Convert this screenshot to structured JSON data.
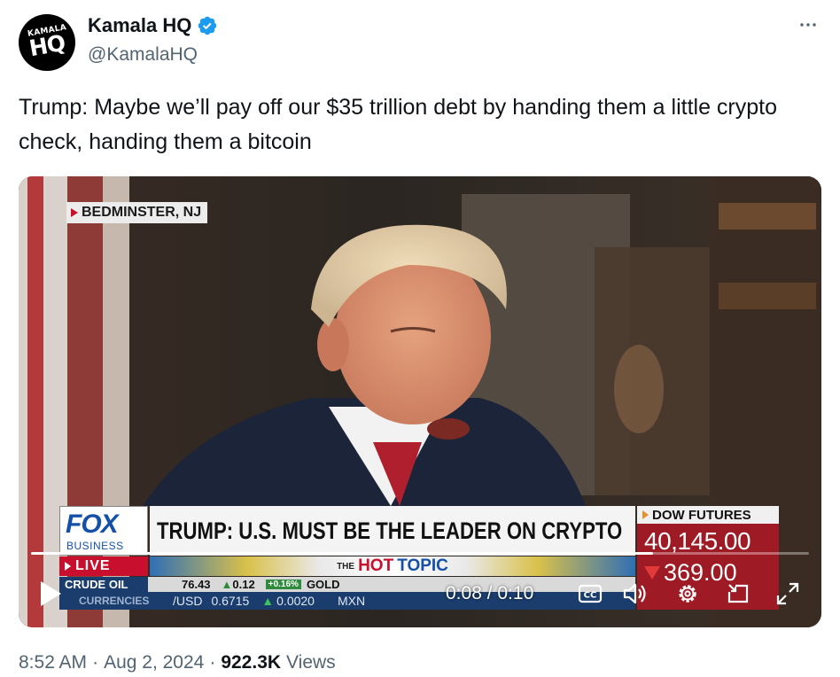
{
  "tweet": {
    "avatar": {
      "top_text": "KAMALA",
      "main_text": "HQ"
    },
    "display_name": "Kamala HQ",
    "verified_icon": "verified-badge-icon",
    "handle": "@KamalaHQ",
    "more_icon": "more-horizontal-icon",
    "text": "Trump: Maybe we’ll pay off our $35 trillion debt by handing them a little crypto check, handing them a bitcoin"
  },
  "video": {
    "location_tag": "BEDMINSTER, NJ",
    "network": {
      "fox": "FOX",
      "business": "BUSINESS",
      "live": "LIVE"
    },
    "headline": "TRUMP: U.S. MUST BE THE LEADER ON CRYPTO",
    "topic": {
      "the": "THE",
      "hot": "HOT",
      "topic": "TOPIC"
    },
    "dow": {
      "label": "DOW FUTURES",
      "value": "40,145.00",
      "change": "369.00"
    },
    "ticker_row1": {
      "label": "CRUDE OIL",
      "price": "76.43",
      "change": "0.12",
      "pct": "+0.16%",
      "next": "GOLD"
    },
    "ticker_row2": {
      "label": "CURRENCIES",
      "pair": "/USD",
      "value": "0.6715",
      "change": "0.0020",
      "next": "MXN"
    },
    "controls": {
      "time": "0:08 / 0:10",
      "progress": 0.8,
      "play_icon": "play-icon",
      "captions_icon": "closed-captions-icon",
      "volume_icon": "volume-icon",
      "settings_icon": "settings-gear-icon",
      "pip_icon": "picture-in-picture-icon",
      "fullscreen_icon": "fullscreen-icon"
    }
  },
  "footer": {
    "time": "8:52 AM",
    "date": "Aug 2, 2024",
    "views_count": "922.3K",
    "views_label": "Views"
  }
}
